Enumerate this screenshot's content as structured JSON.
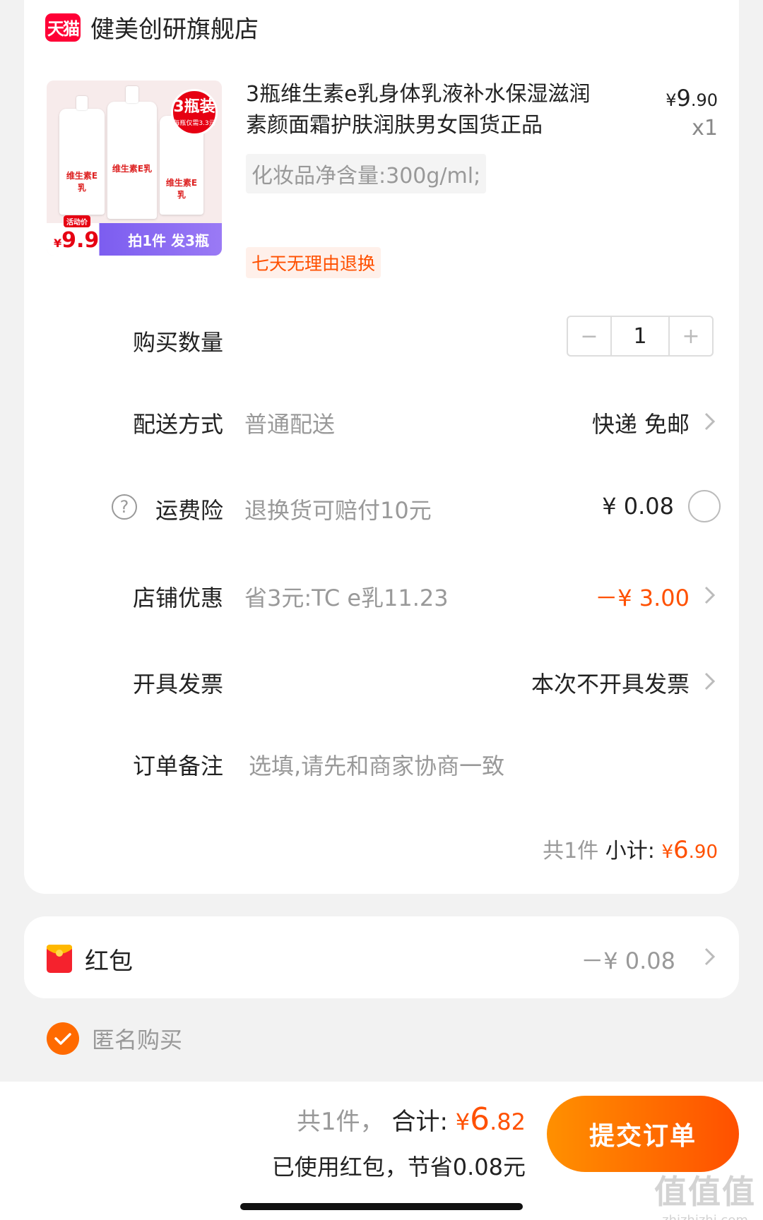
{
  "shop": {
    "badge": "天猫",
    "name": "健美创研旗舰店"
  },
  "product": {
    "title": "3瓶维生素e乳身体乳液补水保湿滋润素颜面霜护肤润肤男女国货正品",
    "price_currency": "¥",
    "price_int": "9",
    "price_dec": ".90",
    "quantity": "x1",
    "spec": "化妆品净含量:300g/ml;",
    "tag": "七天无理由退换",
    "image": {
      "badge_big": "3瓶装",
      "badge_small": "每瓶仅需3.3元",
      "bottle_label": "维生素E乳",
      "promo_tag": "活动价",
      "promo_price": "9.9",
      "promo_currency": "¥",
      "promo_text": "拍1件 发3瓶"
    }
  },
  "quantity_row": {
    "label": "购买数量",
    "value": "1",
    "minus": "−",
    "plus": "+"
  },
  "delivery_row": {
    "label": "配送方式",
    "sub": "普通配送",
    "value": "快递 免邮"
  },
  "insurance_row": {
    "label": "运费险",
    "help": "?",
    "sub": "退换货可赔付10元",
    "value": "¥ 0.08"
  },
  "discount_row": {
    "label": "店铺优惠",
    "sub": "省3元:TC e乳11.23",
    "value": "－¥ 3.00"
  },
  "invoice_row": {
    "label": "开具发票",
    "value": "本次不开具发票"
  },
  "note_row": {
    "label": "订单备注",
    "placeholder": "选填,请先和商家协商一致"
  },
  "subtotal": {
    "count": "共1件",
    "label": "小计:",
    "currency": "¥",
    "int": "6",
    "dec": ".90"
  },
  "red_packet": {
    "label": "红包",
    "value": "－¥ 0.08"
  },
  "anonymous": {
    "label": "匿名购买",
    "checked": true
  },
  "footer": {
    "count": "共1件，",
    "label": "合计:",
    "currency": "¥",
    "int": "6",
    "dec": ".82",
    "saved": "已使用红包，节省0.08元",
    "submit": "提交订单"
  },
  "watermark": {
    "line1": "值值值",
    "line2": "zhizhizhi.com"
  },
  "colors": {
    "accent": "#ff5000",
    "tmall": "#ff0036",
    "button_start": "#ff9000"
  }
}
